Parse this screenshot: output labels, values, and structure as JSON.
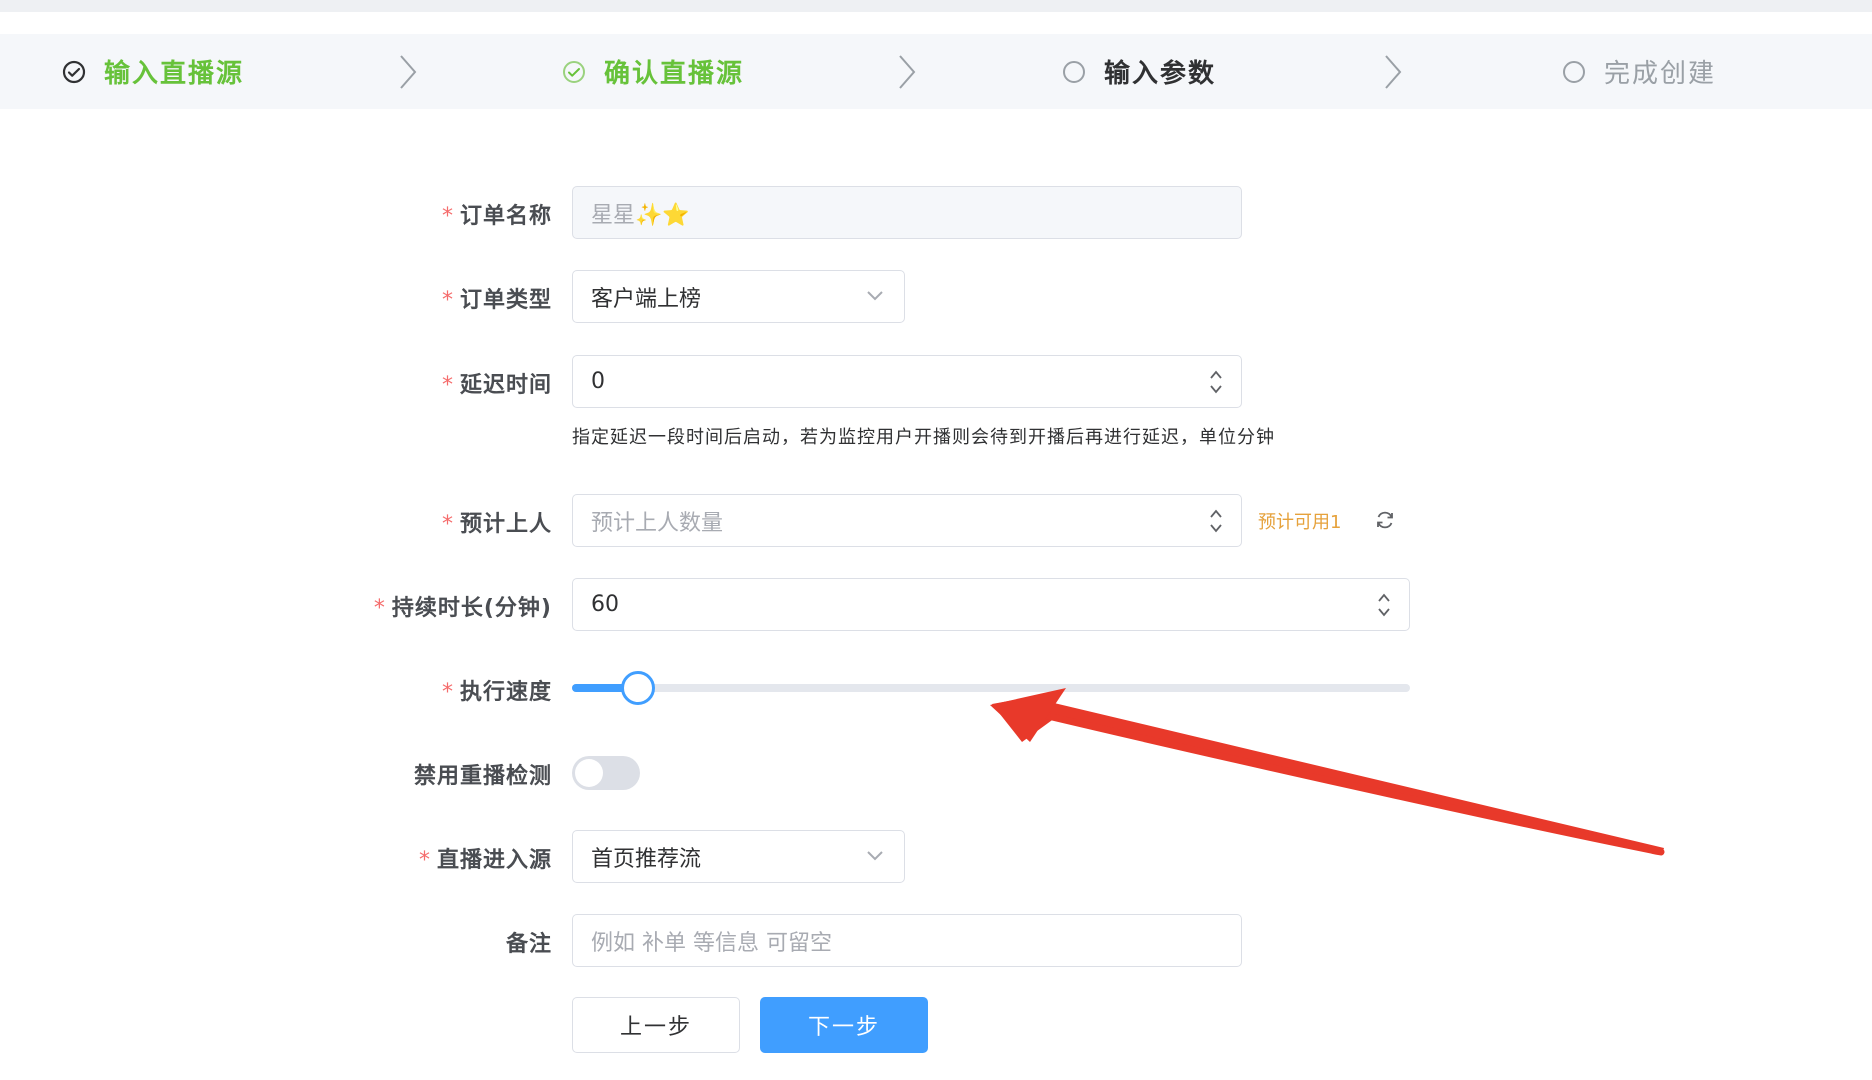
{
  "steps": [
    {
      "label": "输入直播源",
      "state": "done"
    },
    {
      "label": "确认直播源",
      "state": "done"
    },
    {
      "label": "输入参数",
      "state": "active"
    },
    {
      "label": "完成创建",
      "state": "wait"
    }
  ],
  "form": {
    "order_name": {
      "label": "订单名称",
      "value": "星星✨⭐"
    },
    "order_type": {
      "label": "订单类型",
      "value": "客户端上榜"
    },
    "delay": {
      "label": "延迟时间",
      "value": "0",
      "hint": "指定延迟一段时间后启动，若为监控用户开播则会待到开播后再进行延迟，单位分钟"
    },
    "expected_users": {
      "label": "预计上人",
      "placeholder": "预计上人数量",
      "available": "预计可用1"
    },
    "duration": {
      "label": "持续时长(分钟)",
      "value": "60"
    },
    "speed": {
      "label": "执行速度",
      "level": 0.06
    },
    "disable_replay": {
      "label": "禁用重播检测",
      "enabled": false
    },
    "entry_source": {
      "label": "直播进入源",
      "value": "首页推荐流"
    },
    "remark": {
      "label": "备注",
      "placeholder": "例如 补单 等信息 可留空"
    }
  },
  "buttons": {
    "prev": "上一步",
    "next": "下一步"
  },
  "colors": {
    "primary": "#409eff",
    "success": "#67c23a",
    "required": "#f56c6c",
    "warning": "#e6a23c",
    "annotation_arrow": "#e8392a"
  }
}
